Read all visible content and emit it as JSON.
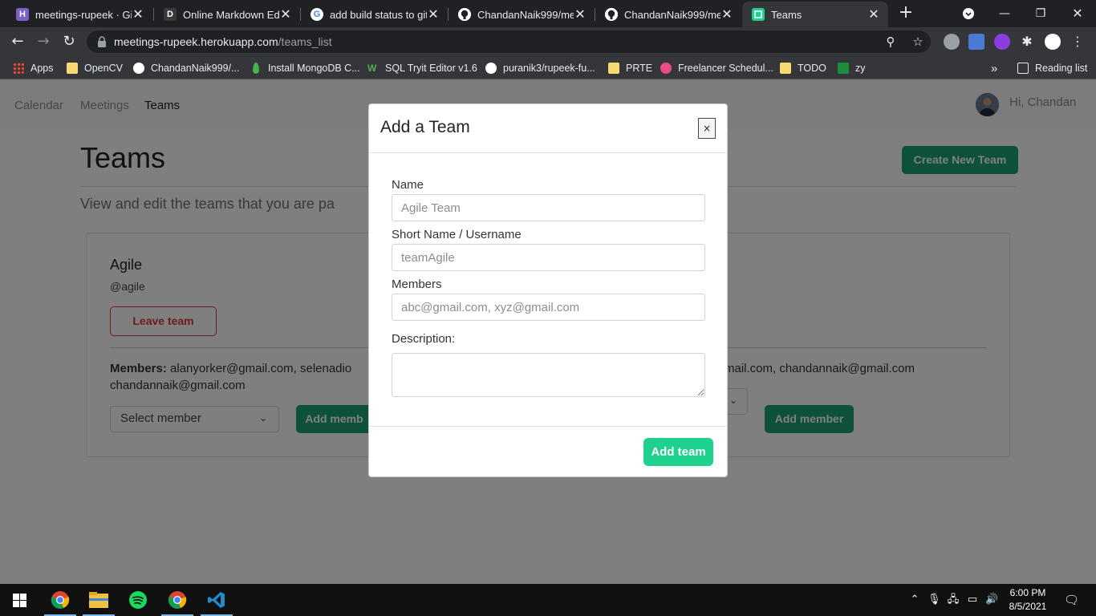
{
  "browser": {
    "tabs": [
      {
        "title": "meetings-rupeek · Git",
        "favicon": "heroku-icon",
        "color": "#7b5fc4",
        "glyph": "H"
      },
      {
        "title": "Online Markdown Edit",
        "favicon": "dillinger-icon",
        "color": "#3a3a3a",
        "glyph": "D"
      },
      {
        "title": "add build status to git",
        "favicon": "google-icon",
        "color": "#ffffff",
        "glyph": "G"
      },
      {
        "title": "ChandanNaik999/mee",
        "favicon": "github-icon",
        "color": "#ffffff",
        "glyph": ""
      },
      {
        "title": "ChandanNaik999/mee",
        "favicon": "github-icon",
        "color": "#ffffff",
        "glyph": ""
      },
      {
        "title": "Teams",
        "favicon": "app-icon",
        "color": "#1fd18e",
        "glyph": ""
      }
    ],
    "url_host": "meetings-rupeek.herokuapp.com",
    "url_path": "/teams_list",
    "bookmarks": [
      {
        "label": "Apps"
      },
      {
        "label": "OpenCV"
      },
      {
        "label": "ChandanNaik999/..."
      },
      {
        "label": "Install MongoDB C..."
      },
      {
        "label": "SQL Tryit Editor v1.6"
      },
      {
        "label": "puranik3/rupeek-fu..."
      },
      {
        "label": "PRTE"
      },
      {
        "label": "Freelancer Schedul..."
      },
      {
        "label": "TODO"
      },
      {
        "label": "zy"
      }
    ],
    "more_bookmarks": "»",
    "reading_list": "Reading list"
  },
  "app": {
    "nav": {
      "calendar": "Calendar",
      "meetings": "Meetings",
      "teams": "Teams"
    },
    "greeting": "Hi, Chandan",
    "page_title": "Teams",
    "create_button": "Create New Team",
    "subtitle": "View and edit the teams that you are pa",
    "team": {
      "name": "Agile",
      "handle": "@agile",
      "leave_button": "Leave team",
      "members_label": "Members:",
      "members_visible": " alanyorker@gmail.com, selenadio",
      "members_right": "mail.com, chandannaik@gmail.com",
      "members_line2": "chandannaik@gmail.com",
      "select_placeholder": "Select member",
      "add_member_button": "Add member",
      "add_member_button_cut": "Add memb"
    }
  },
  "modal": {
    "title": "Add a Team",
    "close": "×",
    "name_label": "Name",
    "name_placeholder": "Agile Team",
    "short_label": "Short Name / Username",
    "short_placeholder": "teamAgile",
    "members_label": "Members",
    "members_placeholder": "abc@gmail.com, xyz@gmail.com",
    "description_label": "Description:",
    "submit": "Add team"
  },
  "taskbar": {
    "time": "6:00 PM",
    "date": "8/5/2021"
  },
  "colors": {
    "accent_green": "#1fd18e",
    "button_green": "#1aa37a",
    "danger": "#dc3545"
  }
}
